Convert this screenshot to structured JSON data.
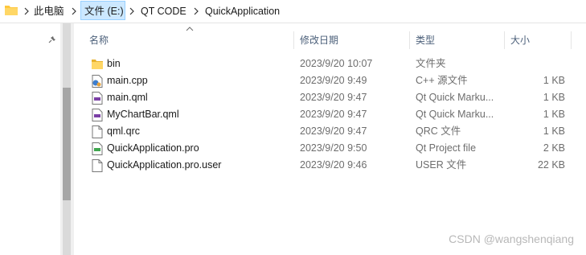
{
  "breadcrumb": {
    "items": [
      {
        "label": "此电脑",
        "selected": false
      },
      {
        "label": "文件 (E:)",
        "selected": true
      },
      {
        "label": "QT CODE",
        "selected": false
      },
      {
        "label": "QuickApplication",
        "selected": false
      }
    ]
  },
  "columns": {
    "name": "名称",
    "date": "修改日期",
    "type": "类型",
    "size": "大小",
    "sorted_by": "name",
    "sort_direction": "ascending"
  },
  "files": [
    {
      "name": "bin",
      "date": "2023/9/20 10:07",
      "type": "文件夹",
      "size": "",
      "icon": "folder-icon"
    },
    {
      "name": "main.cpp",
      "date": "2023/9/20 9:49",
      "type": "C++ 源文件",
      "size": "1 KB",
      "icon": "cpp-file-icon"
    },
    {
      "name": "main.qml",
      "date": "2023/9/20 9:47",
      "type": "Qt Quick Marku...",
      "size": "1 KB",
      "icon": "qml-file-icon"
    },
    {
      "name": "MyChartBar.qml",
      "date": "2023/9/20 9:47",
      "type": "Qt Quick Marku...",
      "size": "1 KB",
      "icon": "qml-file-icon"
    },
    {
      "name": "qml.qrc",
      "date": "2023/9/20 9:47",
      "type": "QRC 文件",
      "size": "1 KB",
      "icon": "generic-file-icon"
    },
    {
      "name": "QuickApplication.pro",
      "date": "2023/9/20 9:50",
      "type": "Qt Project file",
      "size": "2 KB",
      "icon": "pro-file-icon"
    },
    {
      "name": "QuickApplication.pro.user",
      "date": "2023/9/20 9:46",
      "type": "USER 文件",
      "size": "22 KB",
      "icon": "generic-file-icon"
    }
  ],
  "watermark": "CSDN @wangshenqiang",
  "colors": {
    "selection_bg": "#cce8ff",
    "header_text": "#4c607a",
    "folder_yellow": "#ffc83d"
  }
}
